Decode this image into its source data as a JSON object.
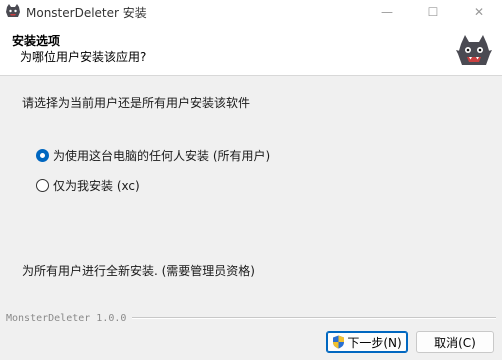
{
  "window": {
    "title": "MonsterDeleter 安装",
    "minimize_glyph": "—",
    "maximize_glyph": "☐",
    "close_glyph": "✕"
  },
  "header": {
    "title": "安装选项",
    "subtitle": "为哪位用户安装该应用?"
  },
  "body": {
    "prompt": "请选择为当前用户还是所有用户安装该软件",
    "options": [
      {
        "label": "为使用这台电脑的任何人安装 (所有用户)",
        "selected": true
      },
      {
        "label": "仅为我安装 (xc)",
        "selected": false
      }
    ],
    "note": "为所有用户进行全新安装. (需要管理员资格)"
  },
  "footer": {
    "brand": "MonsterDeleter 1.0.0"
  },
  "buttons": {
    "next": "下一步(N)",
    "cancel": "取消(C)"
  },
  "colors": {
    "accent": "#0067c0",
    "logo_body": "#4a4a52"
  },
  "icons": {
    "app": "monster-icon",
    "header_logo": "monster-icon",
    "next_shield": "uac-shield-icon"
  }
}
